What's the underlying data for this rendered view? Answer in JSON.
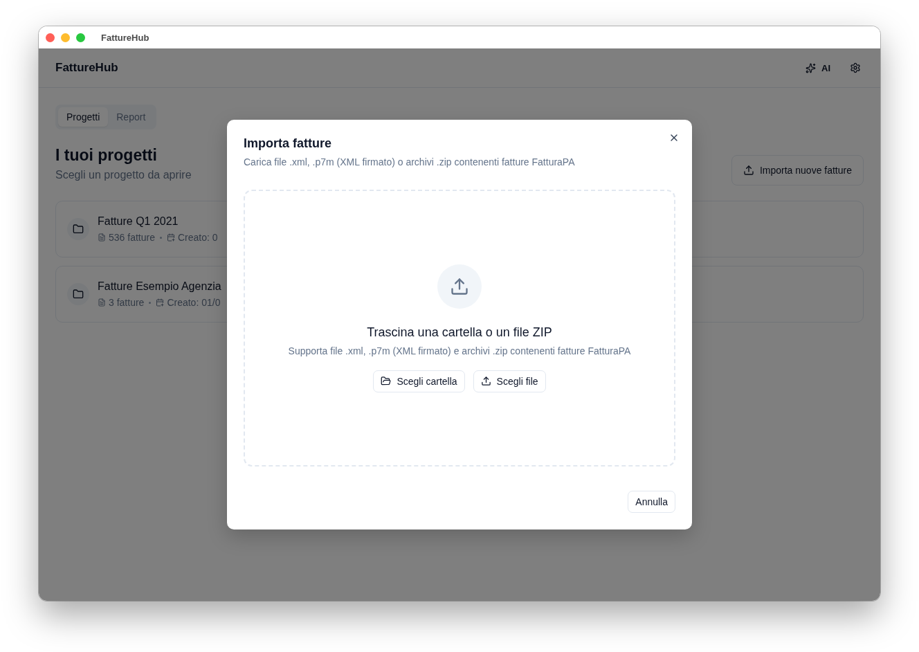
{
  "window": {
    "title": "FattureHub"
  },
  "header": {
    "brand": "FattureHub",
    "ai_label": "AI"
  },
  "tabs": [
    {
      "label": "Progetti",
      "selected": true
    },
    {
      "label": "Report",
      "selected": false
    }
  ],
  "page": {
    "title": "I tuoi progetti",
    "subtitle": "Scegli un progetto da aprire",
    "import_button": "Importa nuove fatture"
  },
  "projects": [
    {
      "name": "Fatture Q1 2021",
      "count": "536 fatture",
      "created": "Creato: 0"
    },
    {
      "name": "Fatture Esempio Agenzia",
      "count": "3 fatture",
      "created": "Creato: 01/0"
    }
  ],
  "dialog": {
    "title": "Importa fatture",
    "description": "Carica file .xml, .p7m (XML firmato) o archivi .zip contenenti fatture FatturaPA",
    "dropzone": {
      "title": "Trascina una cartella o un file ZIP",
      "description": "Supporta file .xml, .p7m (XML firmato) e archivi .zip contenenti fatture FatturaPA",
      "buttons": [
        {
          "kind": "folder",
          "label": "Scegli cartella"
        },
        {
          "kind": "upload",
          "label": "Scegli file"
        }
      ]
    },
    "cancel": "Annulla"
  }
}
